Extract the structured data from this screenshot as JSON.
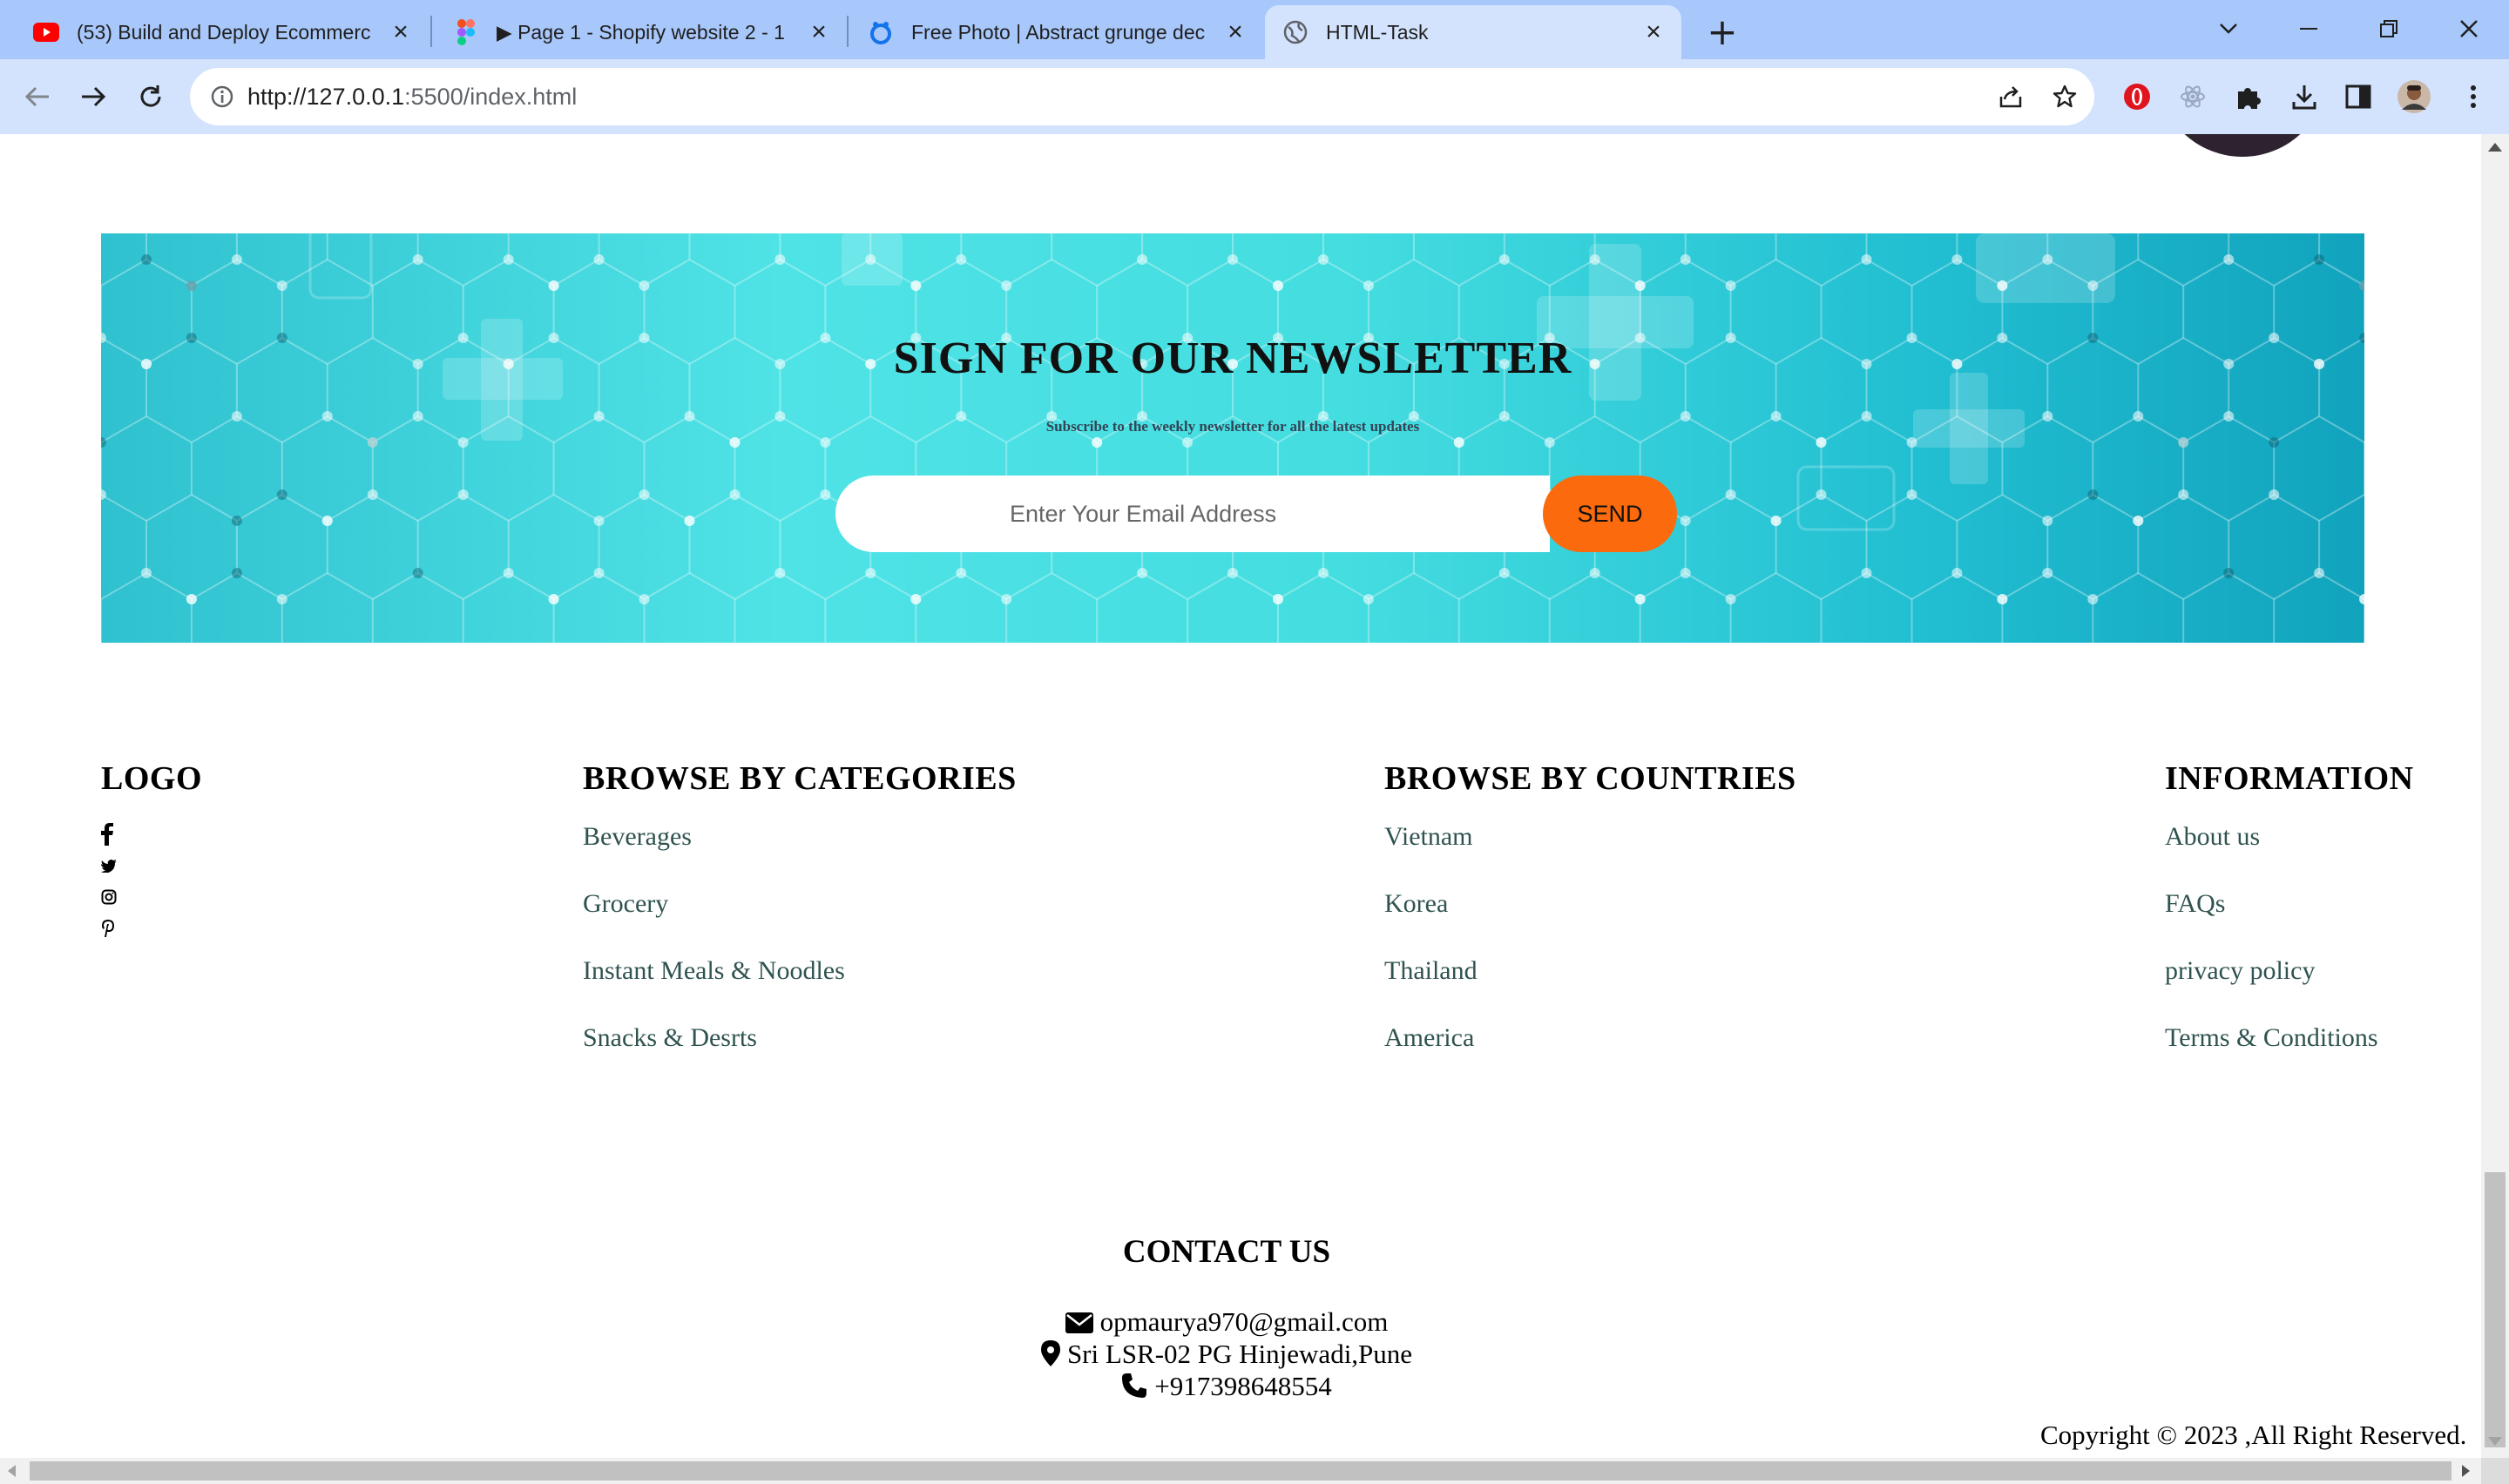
{
  "browser": {
    "tabs": [
      {
        "title": "(53) Build and Deploy Ecommerc",
        "icon": "youtube-icon"
      },
      {
        "title": "▶ Page 1 - Shopify website 2 - 1",
        "icon": "figma-icon"
      },
      {
        "title": "Free Photo | Abstract grunge dec",
        "icon": "freepik-icon"
      },
      {
        "title": "HTML-Task",
        "icon": "globe-icon",
        "active": true
      }
    ],
    "url_host": "http://127.0.0.1",
    "url_path": ":5500/index.html"
  },
  "newsletter": {
    "title": "SIGN FOR OUR NEWSLETTER",
    "subtitle": "Subscribe to the weekly newsletter for all the latest updates",
    "placeholder": "Enter Your Email Address",
    "button": "SEND",
    "accent": "#fb6a0c"
  },
  "footer": {
    "logo": "LOGO",
    "social": [
      "facebook-icon",
      "twitter-icon",
      "instagram-icon",
      "pinterest-icon"
    ],
    "categories": {
      "title": "BROWSE BY CATEGORIES",
      "items": [
        "Beverages",
        "Grocery",
        "Instant Meals & Noodles",
        "Snacks & Desrts"
      ]
    },
    "countries": {
      "title": "BROWSE BY COUNTRIES",
      "items": [
        "Vietnam",
        "Korea",
        "Thailand",
        "America"
      ]
    },
    "information": {
      "title": "INFORMATION",
      "items": [
        "About us",
        "FAQs",
        "privacy policy",
        "Terms & Conditions"
      ]
    }
  },
  "contact": {
    "title": "CONTACT US",
    "email": "opmaurya970@gmail.com",
    "address": "Sri LSR-02 PG Hinjewadi,Pune",
    "phone": "+917398648554"
  },
  "copyright": "Copyright © 2023 ,All Right Reserved."
}
